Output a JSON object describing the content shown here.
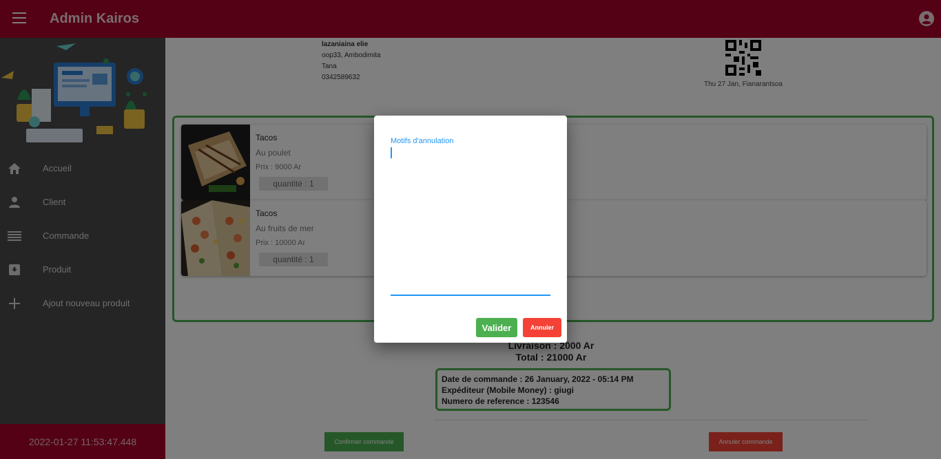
{
  "header": {
    "title": "Admin Kairos",
    "menu_icon": "hamburger-menu-icon",
    "account_icon": "account-circle-icon"
  },
  "sidebar": {
    "items": [
      {
        "label": "Accueil",
        "icon": "home-icon"
      },
      {
        "label": "Client",
        "icon": "person-icon"
      },
      {
        "label": "Commande",
        "icon": "list-icon"
      },
      {
        "label": "Produit",
        "icon": "archive-icon"
      },
      {
        "label": "Ajout nouveau produit",
        "icon": "plus-icon"
      }
    ],
    "footer_datetime": "2022-01-27 11:53:47.448"
  },
  "client": {
    "name": "lazaniaina elie",
    "address": "oop33, Ambodimita",
    "city": "Tana",
    "phone": "0342589632"
  },
  "qr": {
    "caption": "Thu 27 Jan, Fianarantsoa"
  },
  "products": [
    {
      "name": "Tacos",
      "description": "Au poulet",
      "price": "Prix : 9000 Ar",
      "quantity": "quantité : 1"
    },
    {
      "name": "Tacos",
      "description": "Au fruits de mer",
      "price": "Prix : 10000 Ar",
      "quantity": "quantité : 1"
    }
  ],
  "summary": {
    "delivery": "Livraison : 2000 Ar",
    "total": "Total : 21000 Ar"
  },
  "order_meta": {
    "date": "Date de commande : 26 January, 2022 - 05:14 PM",
    "sender": "Expéditeur (Mobile Money) : giugi",
    "reference": "Numero de reference : 123546"
  },
  "actions": {
    "confirm_label": "Confirmer commande",
    "cancel_label": "Annuler commande"
  },
  "dialog": {
    "field_label": "Motifs d'annulation",
    "field_value": "",
    "validate_label": "Valider",
    "cancel_label": "Annuler"
  },
  "colors": {
    "brand": "#a8002b",
    "sidebar": "#4a4a4a",
    "success": "#4caf50",
    "danger": "#f44336",
    "focus": "#2196f3"
  }
}
